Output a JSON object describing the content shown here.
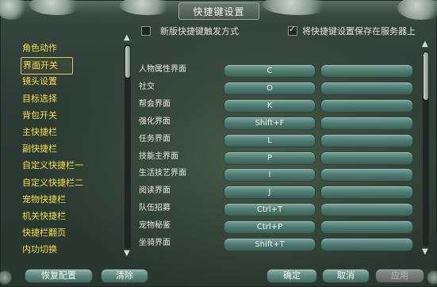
{
  "window": {
    "title": "快捷键设置"
  },
  "options": {
    "new_trigger_label": "新版快捷键触发方式",
    "new_trigger_checked": false,
    "save_server_label": "将快捷键设置保存在服务器上",
    "save_server_checked": true
  },
  "categories": [
    {
      "label": "角色动作",
      "active": false
    },
    {
      "label": "界面开关",
      "active": true
    },
    {
      "label": "镜头设置",
      "active": false
    },
    {
      "label": "目标选择",
      "active": false
    },
    {
      "label": "背包开关",
      "active": false
    },
    {
      "label": "主快捷栏",
      "active": false
    },
    {
      "label": "副快捷栏",
      "active": false
    },
    {
      "label": "自定义快捷栏一",
      "active": false
    },
    {
      "label": "自定义快捷栏二",
      "active": false
    },
    {
      "label": "宠物快捷栏",
      "active": false
    },
    {
      "label": "机关快捷栏",
      "active": false
    },
    {
      "label": "快捷栏翻页",
      "active": false
    },
    {
      "label": "内功切换",
      "active": false
    }
  ],
  "bindings": [
    {
      "label": "人物属性界面",
      "primary": "C",
      "secondary": ""
    },
    {
      "label": "社交",
      "primary": "O",
      "secondary": ""
    },
    {
      "label": "帮会界面",
      "primary": "K",
      "secondary": ""
    },
    {
      "label": "强化界面",
      "primary": "Shift+F",
      "secondary": ""
    },
    {
      "label": "任务界面",
      "primary": "L",
      "secondary": ""
    },
    {
      "label": "技能主界面",
      "primary": "P",
      "secondary": ""
    },
    {
      "label": "生活技艺界面",
      "primary": "I",
      "secondary": ""
    },
    {
      "label": "阅读界面",
      "primary": "J",
      "secondary": ""
    },
    {
      "label": "队伍招募",
      "primary": "Ctrl+T",
      "secondary": ""
    },
    {
      "label": "宠物秘鉴",
      "primary": "Ctrl+P",
      "secondary": ""
    },
    {
      "label": "坐骑界面",
      "primary": "Shift+T",
      "secondary": ""
    }
  ],
  "buttons": {
    "restore": "恢复配置",
    "clear": "清除",
    "ok": "确定",
    "cancel": "取消",
    "apply": "应用"
  },
  "icons": {
    "scroll_up": "▲",
    "scroll_down": "▼"
  }
}
